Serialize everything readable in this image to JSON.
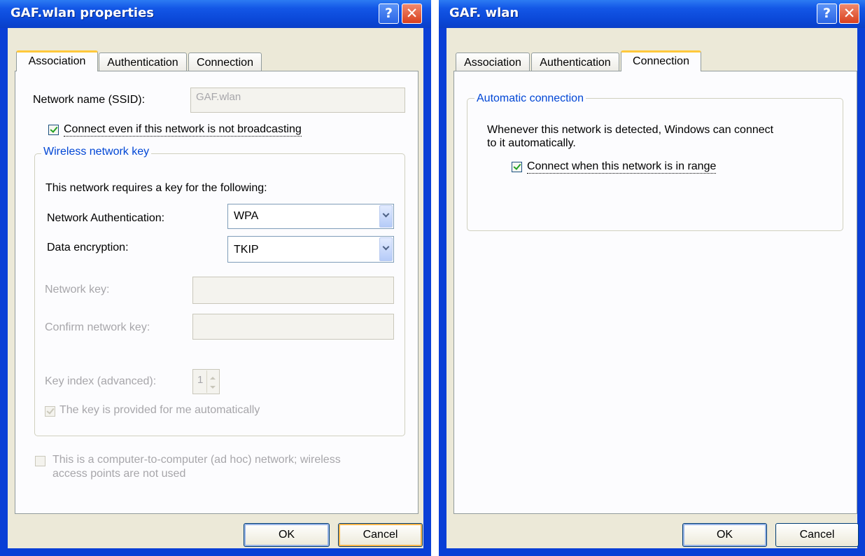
{
  "left_dialog": {
    "title": "GAF.wlan properties",
    "help_icon": "help-question-icon",
    "close_icon": "close-x-icon",
    "tabs": [
      "Association",
      "Authentication",
      "Connection"
    ],
    "active_tab": "Association",
    "network_name_label": "Network name (SSID):",
    "network_name_value": "GAF.wlan",
    "broadcast_checkbox_label": "Connect even if this network is not broadcasting",
    "broadcast_checked": true,
    "group_caption": "Wireless network key",
    "key_required_text": "This network requires a key for the following:",
    "auth_label": "Network Authentication:",
    "auth_value": "WPA",
    "encryption_label": "Data encryption:",
    "encryption_value": "TKIP",
    "network_key_label": "Network key:",
    "network_key_value": "",
    "confirm_key_label": "Confirm network key:",
    "confirm_key_value": "",
    "key_index_label": "Key index (advanced):",
    "key_index_value": "1",
    "auto_key_label": "The key is provided for me automatically",
    "auto_key_checked": true,
    "adhoc_label_line1": "This is a computer-to-computer (ad hoc) network; wireless",
    "adhoc_label_line2": "access points are not used",
    "adhoc_checked": false,
    "ok_label": "OK",
    "cancel_label": "Cancel"
  },
  "right_dialog": {
    "title": "GAF. wlan",
    "help_icon": "help-question-icon",
    "close_icon": "close-x-icon",
    "tabs": [
      "Association",
      "Authentication",
      "Connection"
    ],
    "active_tab": "Connection",
    "group_caption": "Automatic connection",
    "description_line1": "Whenever this network is detected, Windows can connect",
    "description_line2": "to it automatically.",
    "range_checkbox_label": "Connect when this network is in range",
    "range_checked": true,
    "ok_label": "OK",
    "cancel_label": "Cancel"
  },
  "colors": {
    "title_blue": "#0a3fd6",
    "dialog_face": "#ece9d8",
    "group_caption_blue": "#0046d5",
    "active_tab_highlight": "#ffc83c"
  }
}
